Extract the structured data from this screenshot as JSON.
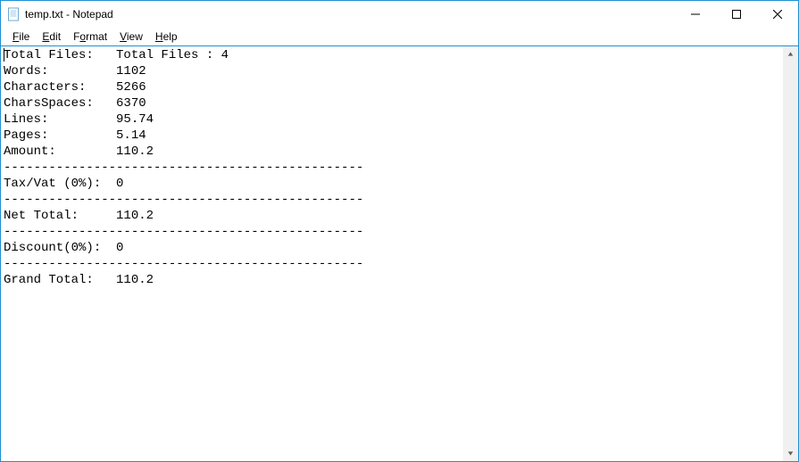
{
  "window": {
    "title": "temp.txt - Notepad"
  },
  "menu": {
    "file": "File",
    "edit": "Edit",
    "format": "Format",
    "view": "View",
    "help": "Help"
  },
  "content": {
    "l01": "Total Files:   Total Files : 4",
    "l02": "Words:         1102",
    "l03": "Characters:    5266",
    "l04": "CharsSpaces:   6370",
    "l05": "Lines:         95.74",
    "l06": "Pages:         5.14",
    "l07": "Amount:        110.2",
    "l08": "------------------------------------------------",
    "l09": "Tax/Vat (0%):  0",
    "l10": "------------------------------------------------",
    "l11": "Net Total:     110.2",
    "l12": "------------------------------------------------",
    "l13": "Discount(0%):  0",
    "l14": "------------------------------------------------",
    "l15": "Grand Total:   110.2"
  }
}
